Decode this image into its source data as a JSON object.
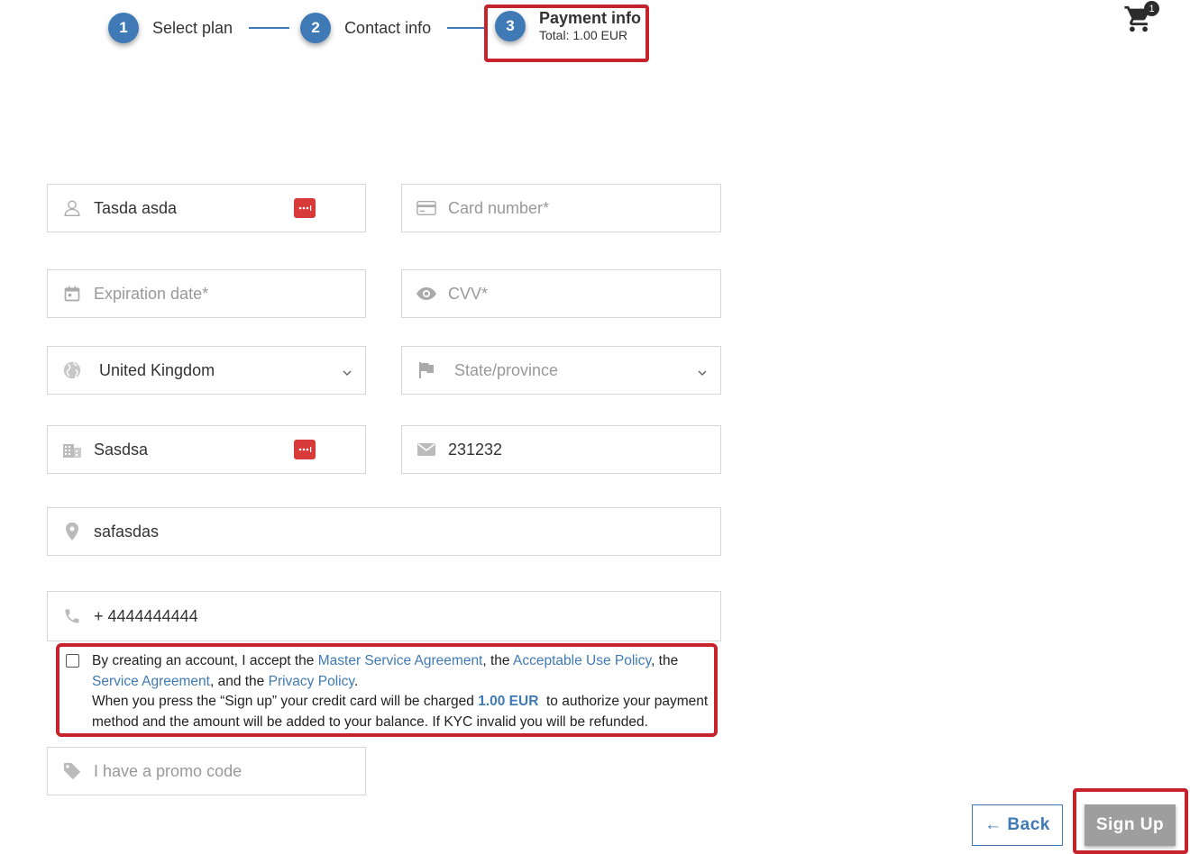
{
  "stepper": {
    "steps": [
      {
        "number": "1",
        "label": "Select plan"
      },
      {
        "number": "2",
        "label": "Contact info"
      },
      {
        "number": "3",
        "label": "Payment info",
        "subtitle": "Total: 1.00 EUR"
      }
    ],
    "accent_color": "#3f7ab6"
  },
  "cart": {
    "icon": "cart-icon",
    "count": "1"
  },
  "form": {
    "name": {
      "value": "Tasda asda",
      "icon": "person-icon"
    },
    "card_number": {
      "placeholder": "Card number*",
      "icon": "credit-card-icon"
    },
    "expiration": {
      "placeholder": "Expiration date*",
      "icon": "calendar-icon"
    },
    "cvv": {
      "placeholder": "CVV*",
      "icon": "eye-icon"
    },
    "country": {
      "value": "United Kingdom",
      "icon": "globe-icon"
    },
    "state": {
      "placeholder": "State/province",
      "icon": "flag-icon"
    },
    "city": {
      "value": "Sasdsa",
      "icon": "building-icon"
    },
    "zip": {
      "value": "231232",
      "icon": "envelope-icon"
    },
    "address": {
      "value": "safasdas",
      "icon": "location-pin-icon"
    },
    "phone": {
      "value": "+ 4444444444",
      "icon": "phone-icon"
    },
    "promo": {
      "placeholder": "I have a promo code",
      "icon": "tag-icon"
    }
  },
  "terms": {
    "part1": "By creating an account, I accept the ",
    "link1": "Master Service Agreement",
    "part2": ", the ",
    "link2": "Acceptable Use Policy",
    "part3": ", the",
    "link3": "Service Agreement",
    "part4": ", and the ",
    "link4": "Privacy Policy",
    "part5": ".",
    "charge_prefix": "When you press the “Sign up” your credit card will be charged ",
    "charge_amount": "1.00 EUR",
    "charge_suffix": "  to authorize your payment method and the amount will be added to your balance. If KYC invalid you will be refunded."
  },
  "buttons": {
    "back": "← Back",
    "signup": "Sign Up"
  },
  "colors": {
    "highlight": "#c6232c",
    "password_manager_badge": "#d83a3a",
    "signup_disabled": "#9e9e9e"
  }
}
